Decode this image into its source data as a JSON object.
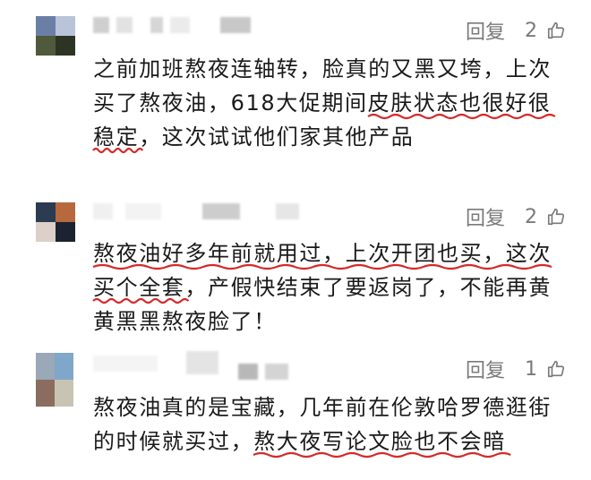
{
  "reply_label": "回复",
  "comments": [
    {
      "likes": "2",
      "text_a": "之前加班熬夜连轴转，脸真的又黑又垮，上次\n买了熬夜油，618大促期间",
      "hl_1": "皮肤状态也很好很",
      "text_b": "\n",
      "hl_2": "稳定",
      "text_c": "，这次试试他们家其他产品"
    },
    {
      "likes": "2",
      "hl_1": "熬夜油好多年前就用过，上次开团也买，这次",
      "text_b": "\n",
      "hl_2": "买个全套",
      "text_c": "，产假快结束了要返岗了，不能再黄\n黄黑黑熬夜脸了！"
    },
    {
      "likes": "1",
      "text_a": "熬夜油真的是宝藏，几年前在伦敦哈罗德逛街\n的时候就买过，",
      "hl_1": "熬大夜写论文脸也不会暗"
    }
  ]
}
